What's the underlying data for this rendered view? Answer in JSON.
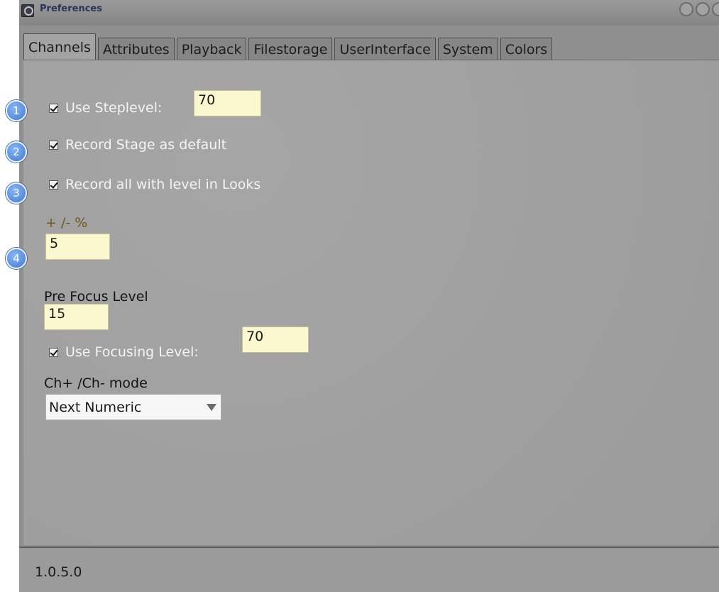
{
  "window": {
    "title": "Preferences"
  },
  "tabs": [
    {
      "label": "Channels",
      "active": true
    },
    {
      "label": "Attributes",
      "active": false
    },
    {
      "label": "Playback",
      "active": false
    },
    {
      "label": "Filestorage",
      "active": false
    },
    {
      "label": "UserInterface",
      "active": false
    },
    {
      "label": "System",
      "active": false
    },
    {
      "label": "Colors",
      "active": false
    }
  ],
  "channels": {
    "use_steplevel": {
      "label": "Use Steplevel:",
      "checked": true,
      "value": "70"
    },
    "record_stage": {
      "label": "Record Stage as default",
      "checked": true
    },
    "record_all": {
      "label": "Record all with level in Looks",
      "checked": true
    },
    "plus_minus": {
      "label": "+ /- %",
      "value": "5"
    },
    "pre_focus": {
      "label": "Pre Focus Level",
      "value": "15"
    },
    "use_focusing": {
      "label": "Use Focusing Level:",
      "checked": true,
      "value": "70"
    },
    "ch_mode": {
      "label": "Ch+ /Ch- mode",
      "selected": "Next Numeric"
    }
  },
  "status": {
    "version": "1.0.5.0"
  },
  "callouts": [
    "1",
    "2",
    "3",
    "4"
  ],
  "colors": {
    "input_bg": "#fbf7cf",
    "callout": "#3b78d4"
  }
}
